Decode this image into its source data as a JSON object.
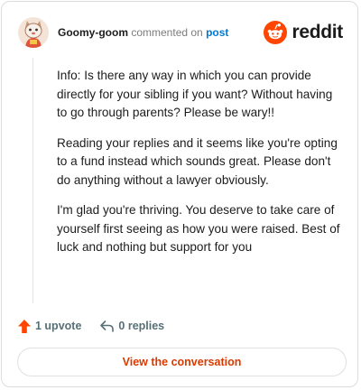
{
  "header": {
    "username": "Goomy-goom",
    "action": "commented on",
    "post_link": "post",
    "brand_name": "reddit"
  },
  "comment": {
    "paragraphs": [
      "Info: Is there any way in which you can provide directly for your sibling if you want? Without having to go through parents? Please be wary!!",
      "Reading your replies and it seems like you're opting to a fund instead which sounds great. Please don't do anything without a lawyer obviously.",
      "I'm glad you're thriving. You deserve to take care of yourself first seeing as how you were raised. Best of luck and nothing but support for you"
    ]
  },
  "footer": {
    "upvotes_label": "1 upvote",
    "replies_label": "0 replies"
  },
  "cta": {
    "label": "View the conversation"
  },
  "icons": {
    "upvote": "upvote-arrow-icon",
    "reply": "reply-arrow-icon",
    "brand": "reddit-snoo-icon"
  },
  "colors": {
    "accent": "#ff4500",
    "link": "#0079d3",
    "cta_text": "#d93a00",
    "muted": "#7c7c7c"
  }
}
